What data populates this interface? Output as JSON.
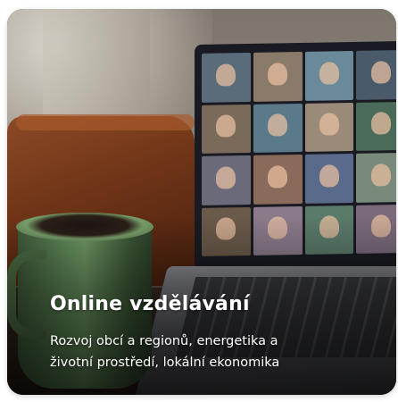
{
  "card": {
    "title": "Online vzdělávání",
    "description_line1": "Rozvoj obcí a regionů, energetika a",
    "description_line2": "životní prostředí, lokální ekonomika"
  },
  "image": {
    "subject": "laptop-video-call-with-mug-icon"
  },
  "colors": {
    "title_text": "#ffffff",
    "description_text": "#ffffff",
    "mug": "#5f8a58",
    "chair": "#6e3417"
  }
}
